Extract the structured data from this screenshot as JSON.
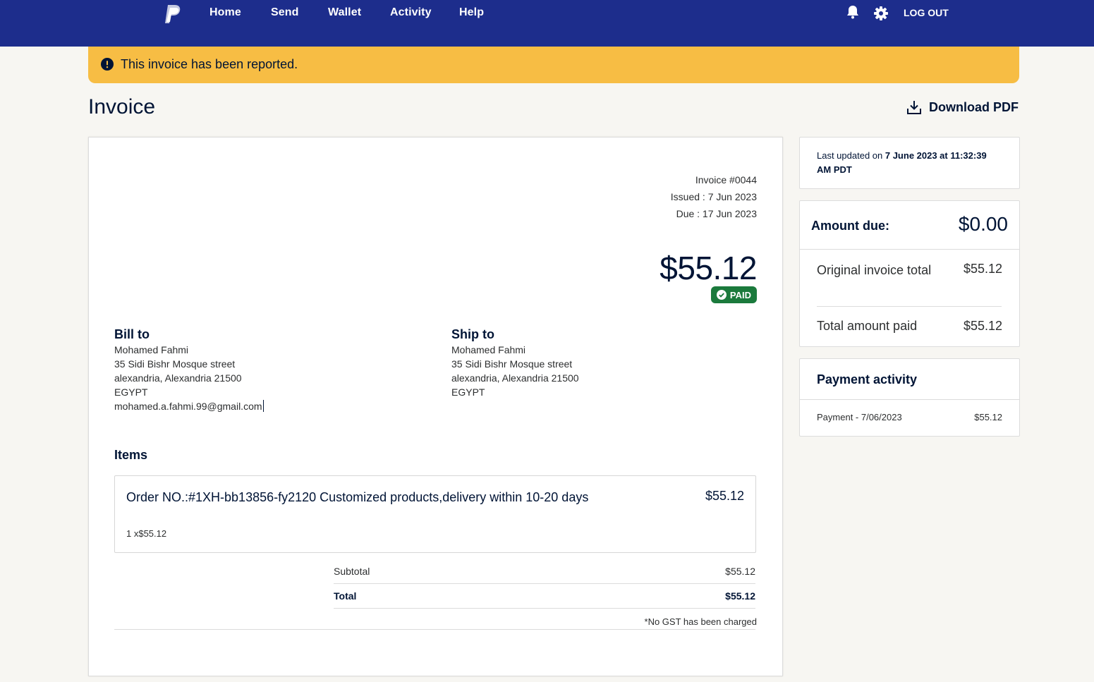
{
  "nav": {
    "logo_icon": "paypal-logo",
    "links": [
      "Home",
      "Send",
      "Wallet",
      "Activity",
      "Help"
    ],
    "notification_icon": "bell-icon",
    "settings_icon": "gear-icon",
    "logout_label": "LOG OUT"
  },
  "alert": {
    "icon": "exclamation-circle-icon",
    "text": "This invoice has been reported."
  },
  "page": {
    "title": "Invoice",
    "download_label": "Download PDF",
    "download_icon": "download-icon"
  },
  "invoice": {
    "number": "Invoice #0044",
    "issued": "Issued : 7 Jun 2023",
    "due": "Due : 17 Jun 2023",
    "amount": "$55.12",
    "status": "PAID",
    "bill_to": {
      "heading": "Bill to",
      "name": "Mohamed Fahmi",
      "street": "35 Sidi Bishr Mosque street",
      "city": "alexandria, Alexandria 21500",
      "country": "EGYPT",
      "email": "mohamed.a.fahmi.99@gmail.com"
    },
    "ship_to": {
      "heading": "Ship to",
      "name": "Mohamed Fahmi",
      "street": "35 Sidi Bishr Mosque street",
      "city": "alexandria, Alexandria 21500",
      "country": "EGYPT"
    },
    "items_heading": "Items",
    "items": [
      {
        "description": "Order NO.:#1XH-bb13856-fy2120 Customized products,delivery within 10-20 days",
        "price": "$55.12",
        "quantity": "1 x$55.12"
      }
    ],
    "subtotal_label": "Subtotal",
    "subtotal_value": "$55.12",
    "total_label": "Total",
    "total_value": "$55.12",
    "tax_note": "*No GST has been charged"
  },
  "sidebar": {
    "updated_prefix": "Last updated on ",
    "updated_value": "7 June 2023 at 11:32:39 AM PDT",
    "amount_due_label": "Amount due:",
    "amount_due_value": "$0.00",
    "original_total_label": "Original invoice total",
    "original_total_value": "$55.12",
    "total_paid_label": "Total amount paid",
    "total_paid_value": "$55.12",
    "activity_title": "Payment activity",
    "activity": [
      {
        "label": "Payment - 7/06/2023",
        "value": "$55.12"
      }
    ]
  },
  "colors": {
    "nav_bg": "#1d2d8c",
    "alert_bg": "#f7bd44",
    "paid_badge": "#1b7a3c",
    "page_bg": "#f7f6f2",
    "text_primary": "#001435"
  }
}
